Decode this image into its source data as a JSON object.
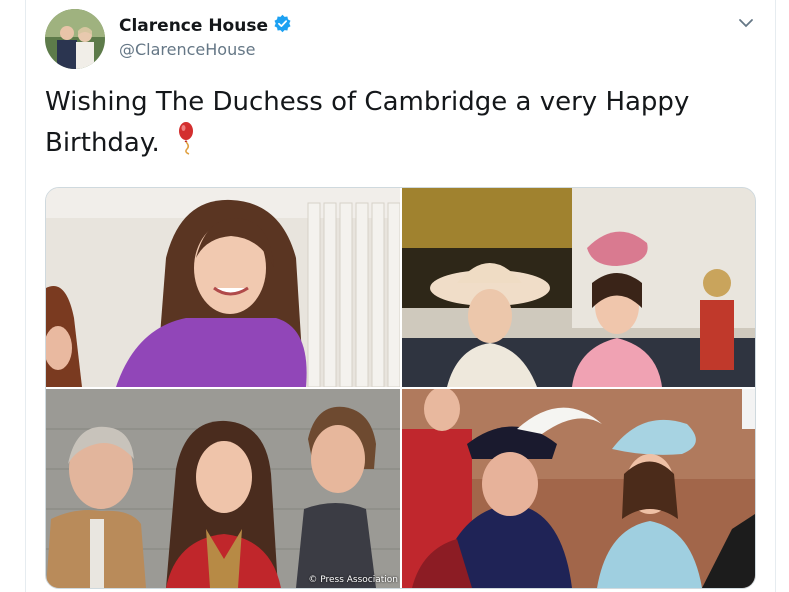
{
  "account": {
    "display_name": "Clarence House",
    "handle": "@ClarenceHouse",
    "verified": true
  },
  "tweet": {
    "text": "Wishing The Duchess of Cambridge a very Happy Birthday."
  },
  "media": {
    "credit": "© Press Association"
  },
  "colors": {
    "verified_badge": "#1da1f2",
    "text": "#14171a",
    "secondary_text": "#657786"
  },
  "icons": [
    "verified-badge-icon",
    "chevron-down-icon",
    "balloon-emoji-icon"
  ]
}
